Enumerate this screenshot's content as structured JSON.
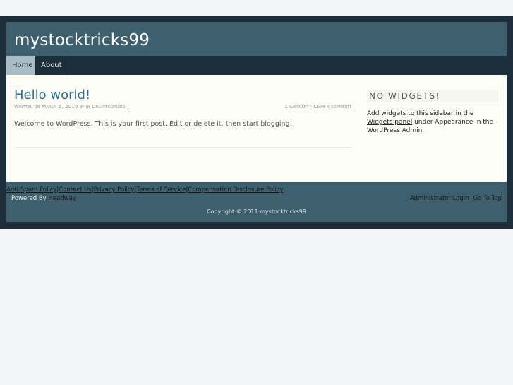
{
  "site": {
    "title": "mystocktricks99"
  },
  "nav": {
    "items": [
      {
        "label": "Home"
      },
      {
        "label": "About"
      }
    ]
  },
  "post": {
    "title": "Hello world!",
    "meta_prefix": "Written on March 5, 2010 by in",
    "category": "Uncategorized",
    "comments_count": "1 Comment",
    "meta_sep": " - ",
    "leave_comment": "Leave a comment!",
    "body": "Welcome to WordPress. This is your first post. Edit or delete it, then start blogging!"
  },
  "sidebar": {
    "title": "NO WIDGETS!",
    "text_before": "Add widgets to this sidebar in the ",
    "link": "Widgets panel",
    "text_after": " under Appearance in the WordPress Admin."
  },
  "footer": {
    "links": [
      {
        "label": "Anti-Spam Policy"
      },
      {
        "label": "Contact Us"
      },
      {
        "label": "Privacy Policy"
      },
      {
        "label": "Terms of Service"
      },
      {
        "label": "Compensation Disclosure Policy"
      }
    ],
    "separator": "|",
    "powered_prefix": "Powered By ",
    "powered_link": "Headway",
    "admin_login": "Administrator Login",
    "go_to_top": "Go To Top",
    "copyright": "Copyright © 2011 mystocktricks99"
  },
  "colors": {
    "background": "#f3f6f9",
    "frame": "#1b2e39",
    "header": "#3e5f6e",
    "content": "#fcfef5",
    "link": "#2f6d91",
    "nav_active": "#a8bcc5"
  }
}
